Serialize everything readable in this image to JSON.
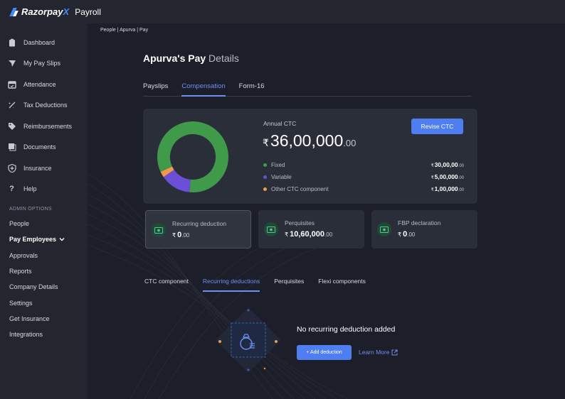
{
  "app": {
    "brand": "Razorpay",
    "brand_x": "X",
    "product": "Payroll"
  },
  "sidebar": {
    "items": [
      {
        "label": "Dashboard",
        "icon": "clipboard-icon"
      },
      {
        "label": "My Pay Slips",
        "icon": "send-icon"
      },
      {
        "label": "Attendance",
        "icon": "calendar-icon"
      },
      {
        "label": "Tax Deductions",
        "icon": "percent-icon"
      },
      {
        "label": "Reimbursements",
        "icon": "tag-icon"
      },
      {
        "label": "Documents",
        "icon": "documents-icon"
      },
      {
        "label": "Insurance",
        "icon": "shield-icon"
      },
      {
        "label": "Help",
        "icon": "help-icon"
      }
    ],
    "admin_label": "ADMIN OPTIONS",
    "admin_items": [
      {
        "label": "People"
      },
      {
        "label": "Pay Employees"
      },
      {
        "label": "Approvals"
      },
      {
        "label": "Reports"
      },
      {
        "label": "Company Details"
      },
      {
        "label": "Settings"
      },
      {
        "label": "Get Insurance"
      },
      {
        "label": "Integrations"
      }
    ]
  },
  "breadcrumb": "People | Apurva  | Pay",
  "page_title": {
    "bold": "Apurva's Pay",
    "light": " Details"
  },
  "tabs": [
    "Payslips",
    "Compensation",
    "Form-16"
  ],
  "active_tab": "Compensation",
  "ctc": {
    "label": "Annual CTC",
    "currency": "₹",
    "value": "36,00,000",
    "decimals": ".00",
    "revise_label": "Revise CTC",
    "breakdown": [
      {
        "label": "Fixed",
        "currency": "₹",
        "amount": "30,00,00",
        "decimals": ".00",
        "color": "#3f9a4a",
        "share": 0.8333
      },
      {
        "label": "Variable",
        "currency": "₹",
        "amount": "5,00,000",
        "decimals": ".00",
        "color": "#6b4fd6",
        "share": 0.1389
      },
      {
        "label": "Other CTC component",
        "currency": "₹",
        "amount": "1,00,000",
        "decimals": ".00",
        "color": "#f09a4a",
        "share": 0.0278
      }
    ]
  },
  "cards": [
    {
      "title": "Recurring deduction",
      "currency": "₹",
      "value": "0",
      "decimals": ".00",
      "icon": "cash-icon"
    },
    {
      "title": "Perquisites",
      "currency": "₹",
      "value": "10,60,000",
      "decimals": ".00",
      "icon": "cash-icon"
    },
    {
      "title": "FBP declaration",
      "currency": "₹",
      "value": "0",
      "decimals": ".00",
      "icon": "cash-icon"
    }
  ],
  "subtabs": [
    "CTC component",
    "Recurring deductions",
    "Perquisites",
    "Flexi components"
  ],
  "active_subtab": "Recurring deductions",
  "empty_state": {
    "title": "No recurring deduction added",
    "add_label": "+ Add deduction",
    "learn_more": "Learn More"
  },
  "colors": {
    "accent": "#4f7ef0",
    "link": "#6f8ef2",
    "panel": "#2a2e39"
  }
}
